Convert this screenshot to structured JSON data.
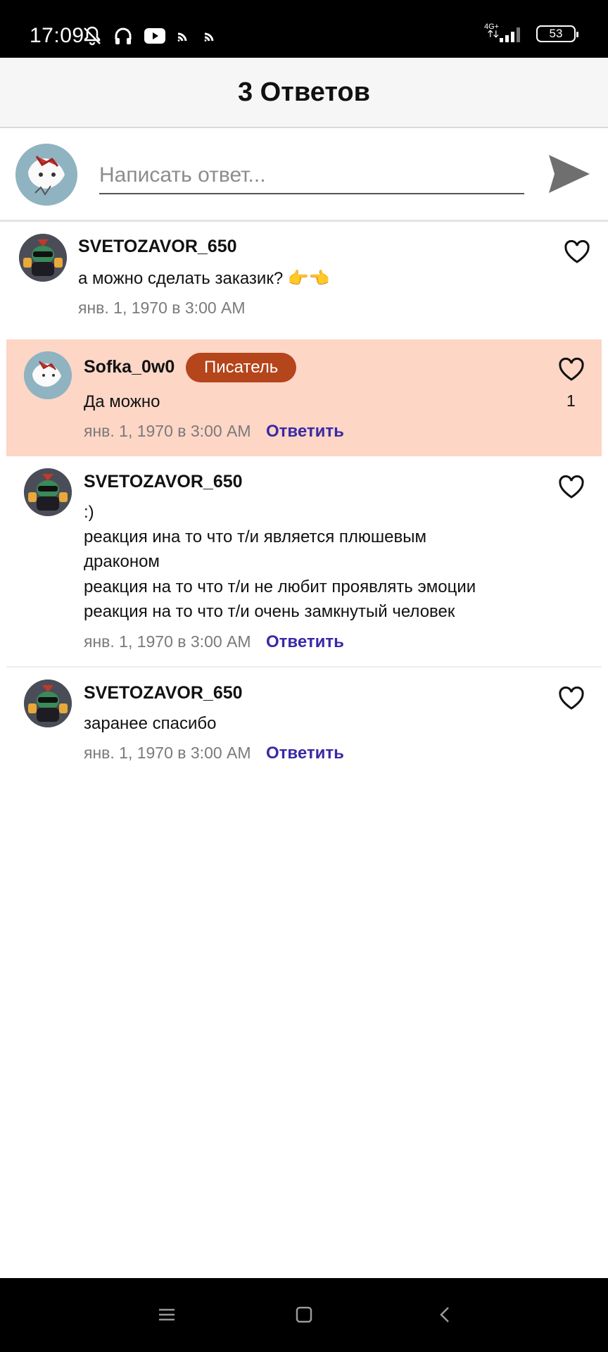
{
  "status_bar": {
    "time": "17:09",
    "network": "4G+",
    "battery": "53"
  },
  "header": {
    "title": "3 Ответов"
  },
  "reply": {
    "placeholder": "Написать ответ..."
  },
  "comments": [
    {
      "username": "SVETOZAVOR_650",
      "text": [
        "а можно сделать заказик? 👉👈"
      ],
      "timestamp": "янв. 1, 1970 в 3:00 AM"
    },
    {
      "username": "Sofka_0w0",
      "badge": "Писатель",
      "text": [
        "Да можно"
      ],
      "timestamp": "янв. 1, 1970 в 3:00 AM",
      "reply_label": "Ответить",
      "like_count": "1"
    },
    {
      "username": "SVETOZAVOR_650",
      "text": [
        ":)",
        "реакция ина то что т/и является плюшевым",
        "драконом",
        "реакция на то что т/и не любит проявлять эмоции",
        "реакция на то что т/и очень замкнутый человек"
      ],
      "timestamp": "янв. 1, 1970 в 3:00 AM",
      "reply_label": "Ответить"
    },
    {
      "username": "SVETOZAVOR_650",
      "text": [
        "заранее спасибо"
      ],
      "timestamp": "янв. 1, 1970 в 3:00 AM",
      "reply_label": "Ответить"
    }
  ],
  "colors": {
    "highlight": "#fdd6c6",
    "badge": "#b5451b",
    "reply_link": "#3a2aa6"
  }
}
